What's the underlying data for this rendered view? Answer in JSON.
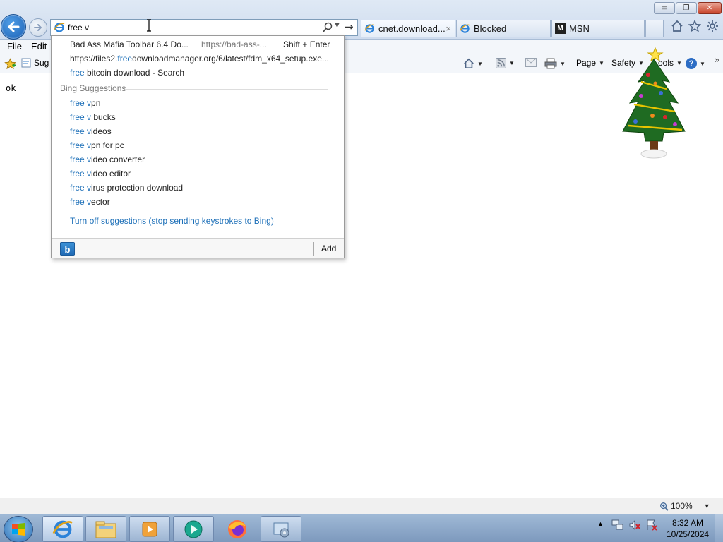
{
  "address": {
    "value": "free v"
  },
  "tabs": [
    {
      "label": "cnet.download...",
      "close": "×"
    },
    {
      "label": "Blocked"
    },
    {
      "label": "MSN",
      "logo": "M"
    }
  ],
  "window": {
    "minimize": "▭",
    "restore": "❐",
    "close": "✕"
  },
  "menu": {
    "file": "File",
    "edit": "Edit"
  },
  "favorites": {
    "suggested_label": "Sug"
  },
  "command_bar": {
    "page": "Page",
    "safety": "Safety",
    "tools": "ools",
    "help": "?"
  },
  "page": {
    "text": "ok"
  },
  "suggestions": {
    "history": [
      {
        "title": "Bad Ass Mafia Toolbar 6.4 Do...",
        "url": "https://bad-ass-...",
        "shortcut": "Shift + Enter"
      },
      {
        "pre": "https://files2.",
        "match": "free",
        "post": "downloadmanager.org/6/latest/fdm_x64_setup.exe..."
      },
      {
        "match": "free",
        "post": " bitcoin download - Search"
      }
    ],
    "header": "Bing Suggestions",
    "bing": [
      {
        "match": "free v",
        "post": "pn"
      },
      {
        "match": "free v",
        "post": " bucks"
      },
      {
        "match": "free v",
        "post": "ideos"
      },
      {
        "match": "free v",
        "post": "pn for pc"
      },
      {
        "match": "free v",
        "post": "ideo converter"
      },
      {
        "match": "free v",
        "post": "ideo editor"
      },
      {
        "match": "free v",
        "post": "irus protection download"
      },
      {
        "match": "free v",
        "post": "ector"
      }
    ],
    "turn_off": "Turn off suggestions (stop sending keystrokes to Bing)",
    "bing_button": "b",
    "add": "Add"
  },
  "status": {
    "zoom": "100%"
  },
  "taskbar": {
    "time": "8:32 AM",
    "date": "10/25/2024"
  },
  "colors": {
    "highlight": "#1c6fb8",
    "title_bar": "#dfe9f5",
    "taskbar": "#9fb9d6"
  }
}
